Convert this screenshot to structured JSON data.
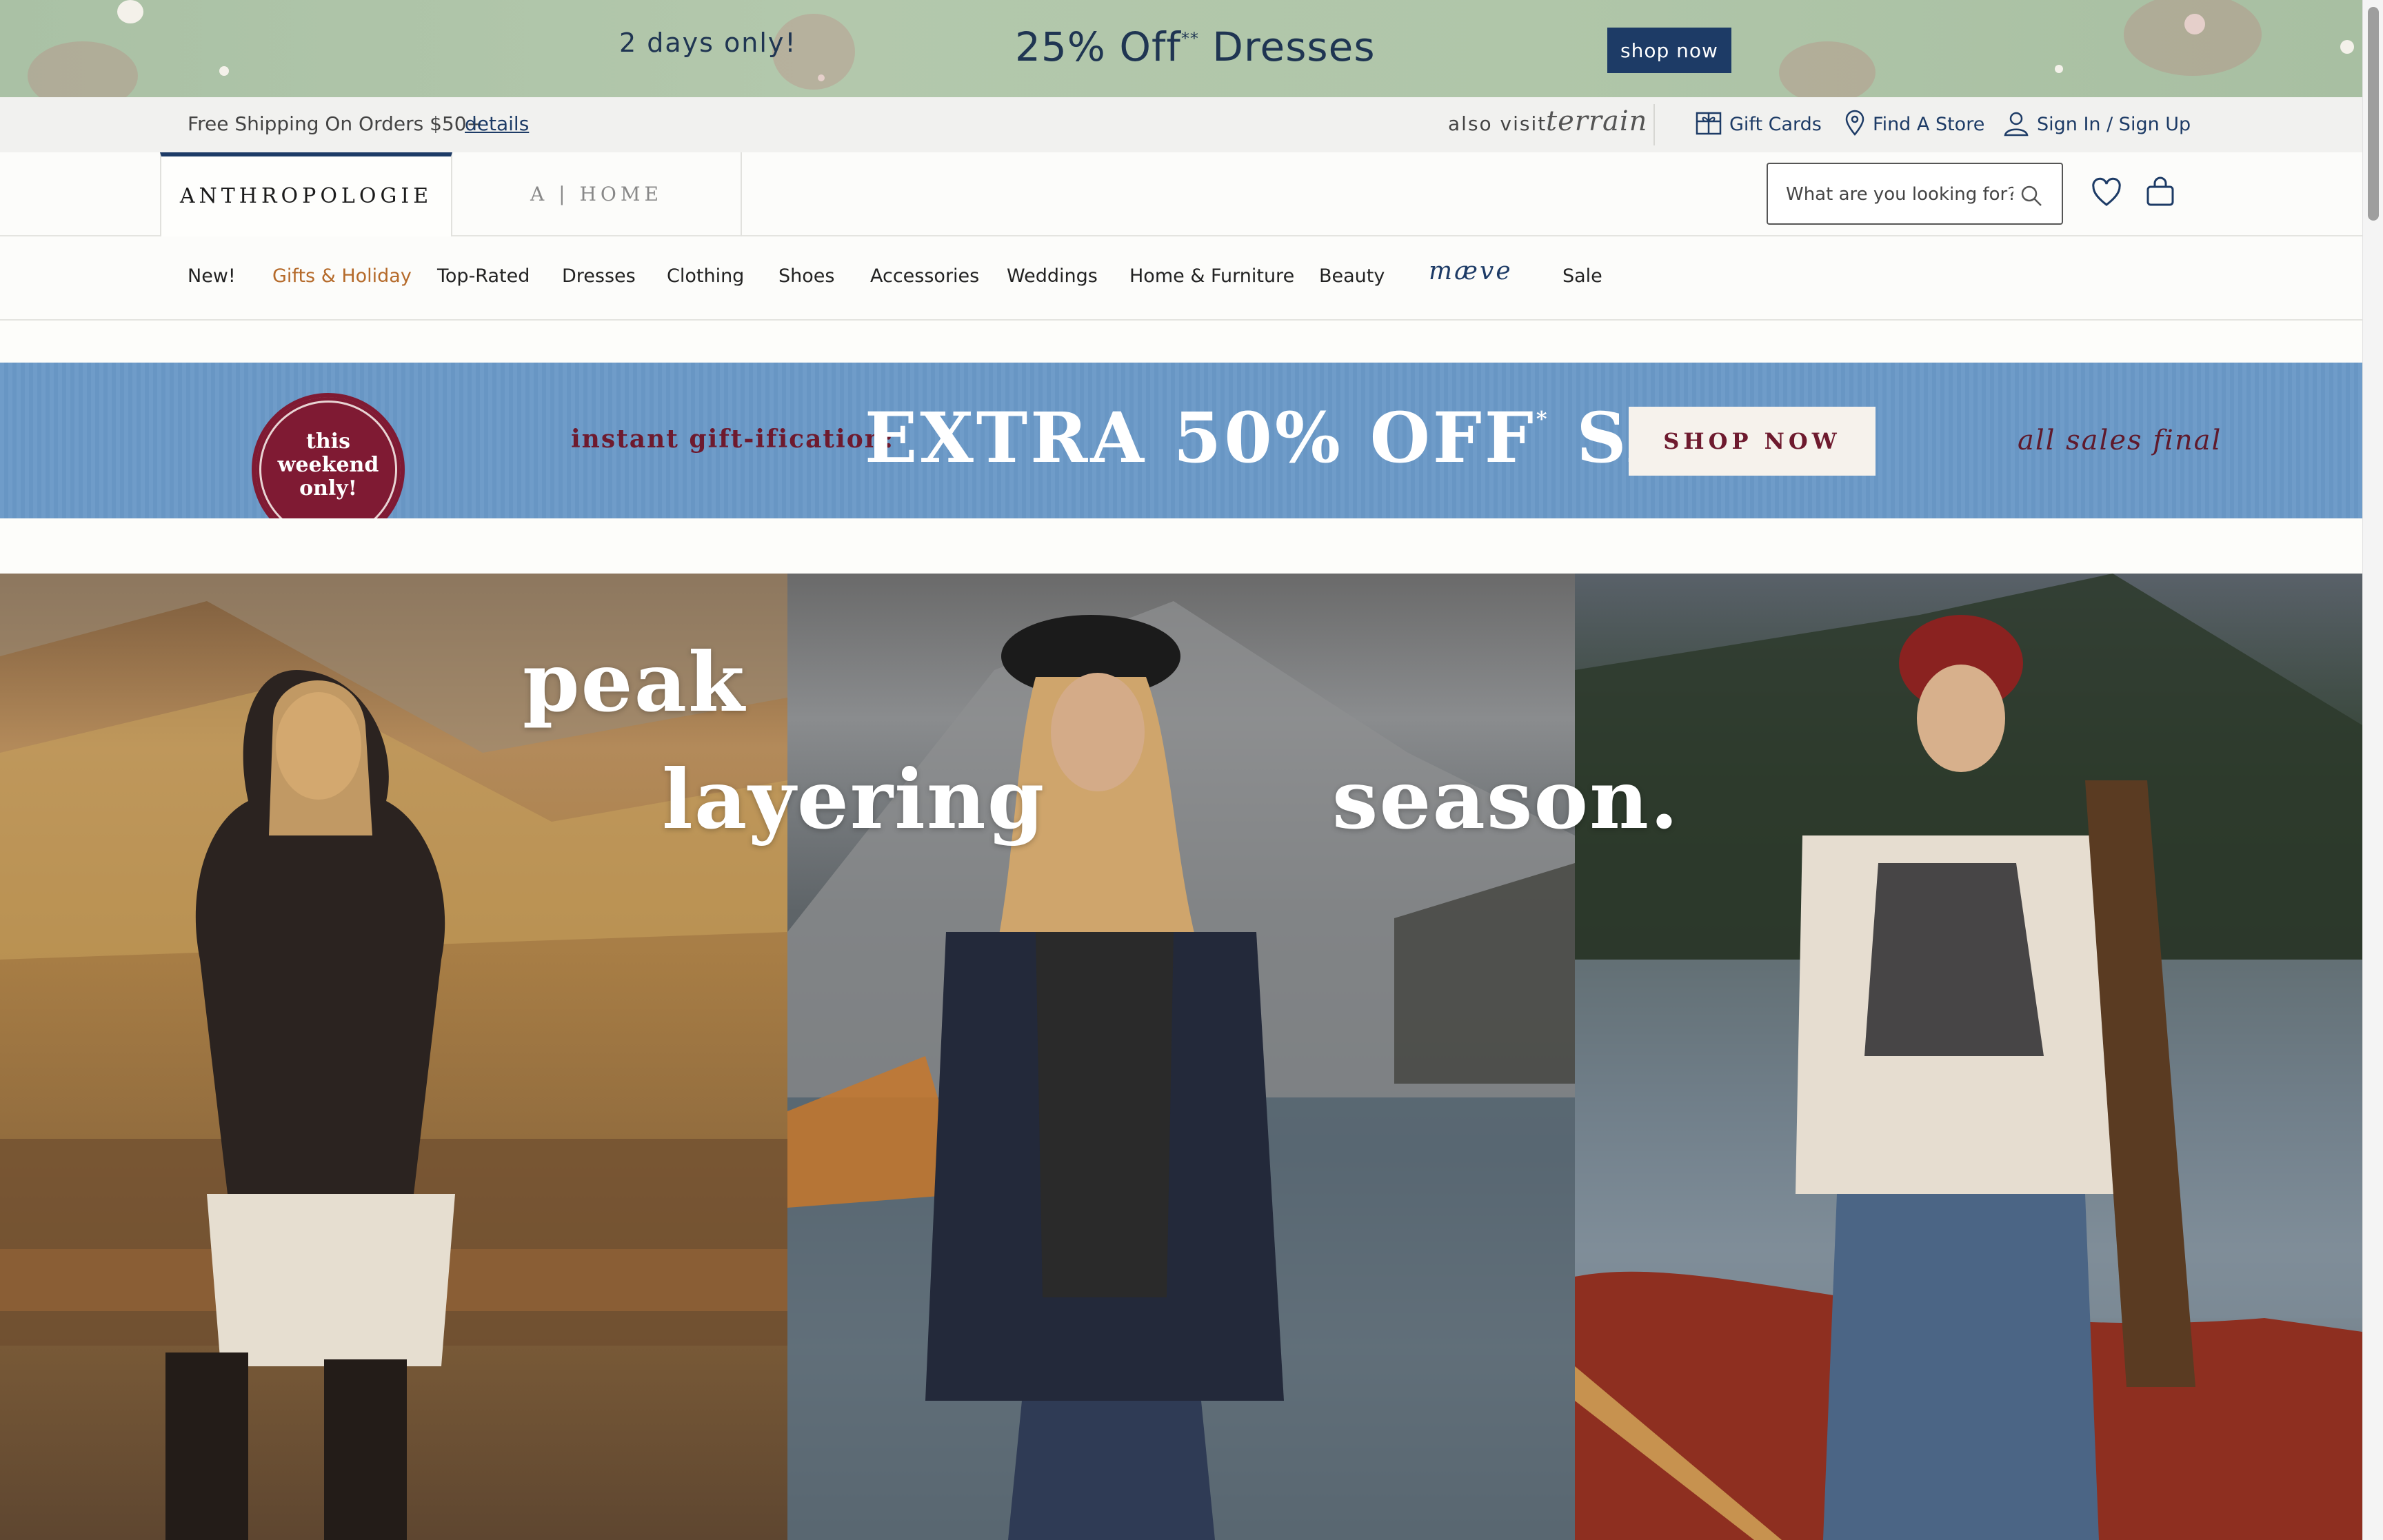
{
  "promo": {
    "days": "2 days only!",
    "headline_prefix": "25% Off",
    "headline_mark": "**",
    "headline_suffix": "Dresses",
    "cta": "shop now"
  },
  "utility": {
    "free_shipping": "Free Shipping On Orders $50+",
    "details": "details",
    "also_visit": "also visit",
    "terrain": "terrain",
    "gift_cards": "Gift Cards",
    "find_store": "Find A Store",
    "sign_in": "Sign In / Sign Up"
  },
  "header": {
    "brand": "ANTHROPOLOGIE",
    "home": "A | HOME",
    "search_placeholder": "What are you looking for?"
  },
  "nav": {
    "items": [
      "New!",
      "Gifts & Holiday",
      "Top-Rated",
      "Dresses",
      "Clothing",
      "Shoes",
      "Accessories",
      "Weddings",
      "Home & Furniture",
      "Beauty",
      "mæve",
      "Sale"
    ]
  },
  "sale_banner": {
    "badge": "this\nweekend\nonly!",
    "lead": "instant gift-ification:",
    "headline": "EXTRA 50% OFF",
    "headline_mark": "*",
    "headline_suffix": "SALE",
    "cta": "SHOP NOW",
    "note": "all sales final"
  },
  "hero": {
    "word1": "peak",
    "word2": "layering",
    "word3": "season."
  },
  "colors": {
    "brand_navy": "#1d3b66",
    "accent_rust": "#b56a2a",
    "promo_green": "#b0c6a9",
    "sale_blue": "#6f9cc9",
    "sale_burgundy": "#7f1a33"
  }
}
